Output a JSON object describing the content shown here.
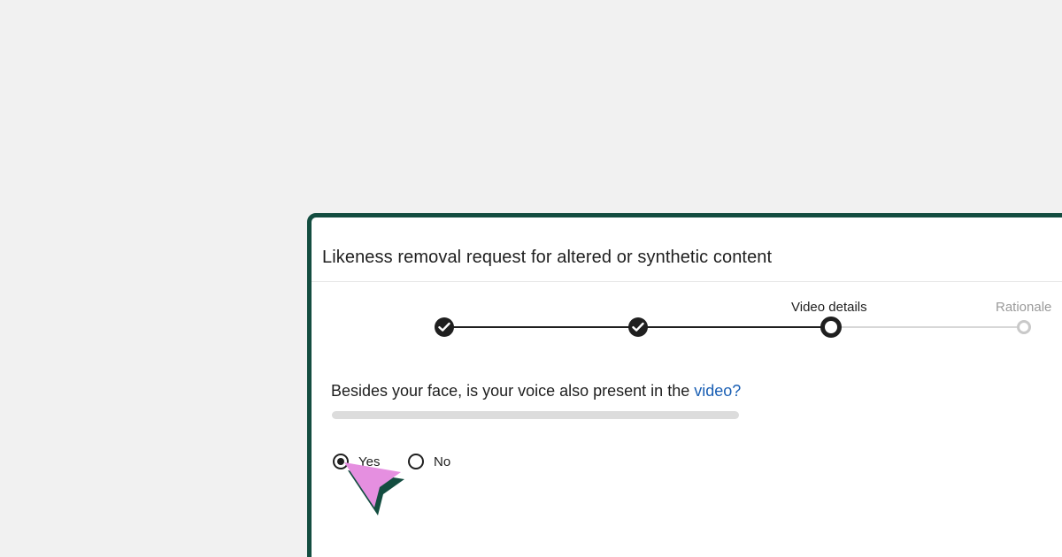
{
  "dialog": {
    "title": "Likeness removal request for altered or synthetic content"
  },
  "stepper": {
    "steps": [
      {
        "label": "",
        "state": "completed",
        "icon": "check-icon"
      },
      {
        "label": "",
        "state": "completed",
        "icon": "check-icon"
      },
      {
        "label": "Video details",
        "state": "current",
        "icon": ""
      },
      {
        "label": "Rationale",
        "state": "pending",
        "icon": ""
      }
    ]
  },
  "question": {
    "text_before": "Besides your face, is your voice also present in the ",
    "link_text": "video?"
  },
  "options": {
    "yes_label": "Yes",
    "no_label": "No",
    "selected": "Yes"
  },
  "colors": {
    "frame": "#134d40",
    "link": "#1a5fb4",
    "cursor_fill": "#e58fe0",
    "cursor_shadow": "#134d40"
  },
  "icons": {
    "cursor": "pointer-arrow-icon"
  }
}
